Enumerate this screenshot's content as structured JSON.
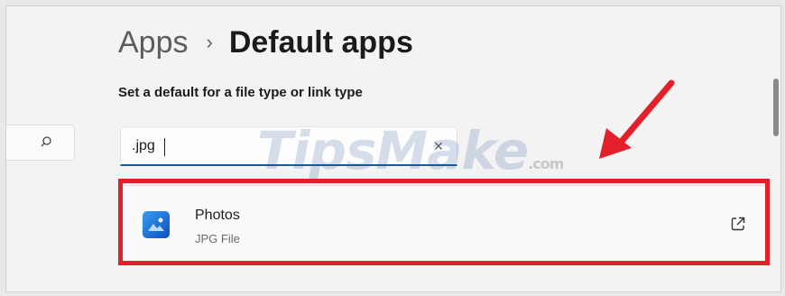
{
  "breadcrumb": {
    "parent": "Apps",
    "separator": "›",
    "current": "Default apps"
  },
  "subtitle": "Set a default for a file type or link type",
  "filetype_search": {
    "value": ".jpg",
    "clear_glyph": "×"
  },
  "left_search": {
    "icon": "search-icon"
  },
  "result": {
    "app_name": "Photos",
    "file_type": "JPG File",
    "app_icon": "photos-app-icon",
    "action_icon": "open-external-icon"
  },
  "watermark": {
    "text": "TipsMake",
    "suffix": ".com"
  },
  "colors": {
    "accent": "#005fb8",
    "highlight": "#e3202a",
    "background": "#f3f3f3"
  }
}
